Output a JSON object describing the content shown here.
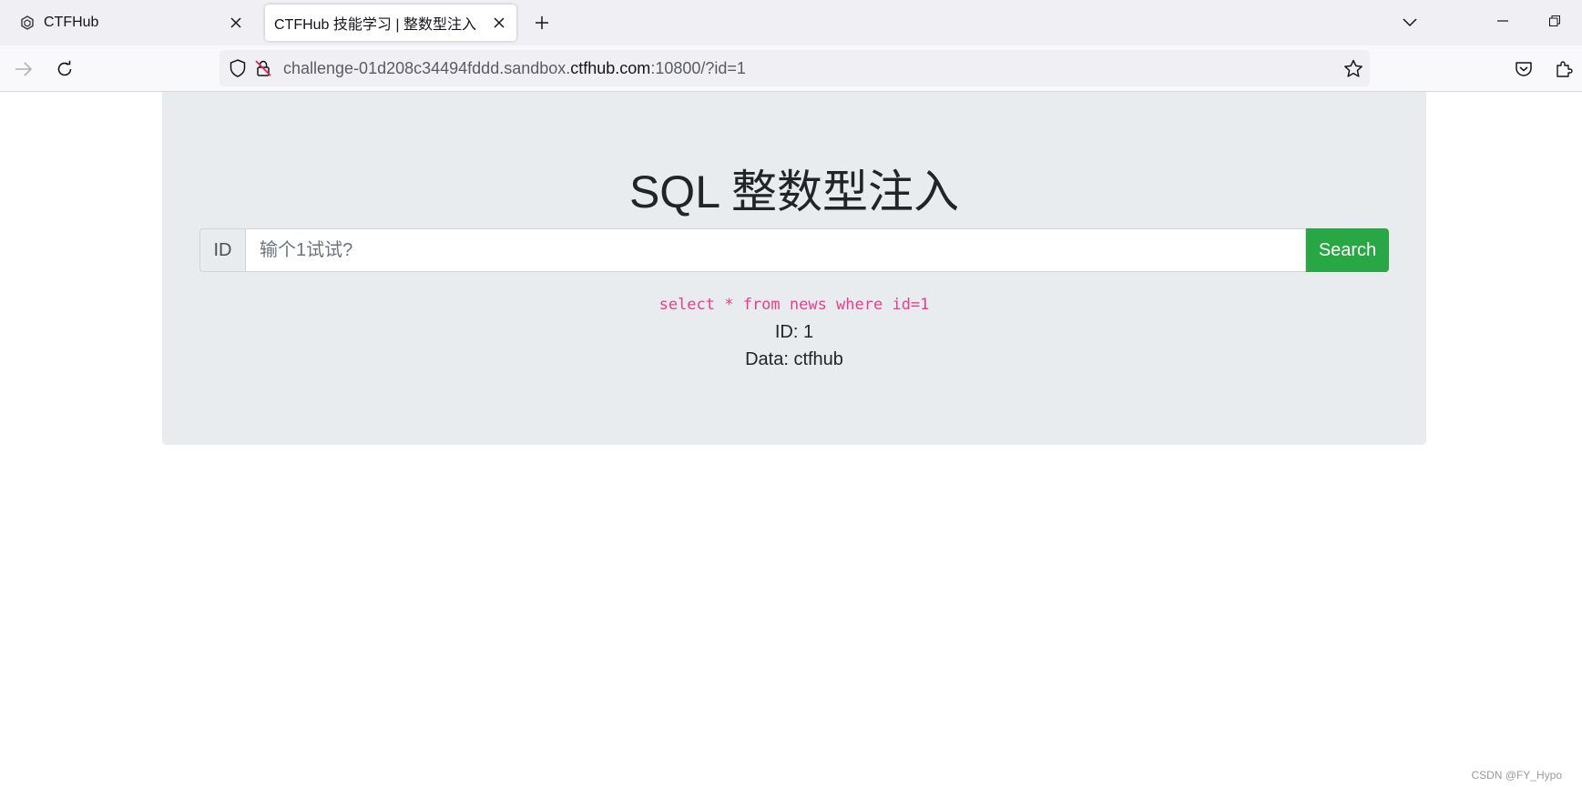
{
  "browser": {
    "tabs": [
      {
        "title": "CTFHub",
        "active": false
      },
      {
        "title": "CTFHub 技能学习 | 整数型注入",
        "active": true
      }
    ],
    "url": {
      "prefix": "challenge-01d208c34494fddd.sandbox.",
      "host": "ctfhub.com",
      "suffix": ":10800/?id=1"
    },
    "icons": {
      "tab_favicon": "ctfhub-favicon-icon",
      "tab_close": "close-icon",
      "new_tab": "plus-icon",
      "tab_list": "chevron-down-icon",
      "minimize": "minimize-icon",
      "restore": "restore-icon",
      "forward": "arrow-right-icon",
      "reload": "reload-icon",
      "tracking_protection": "shield-icon",
      "insecure": "insecure-lock-icon",
      "bookmark": "star-icon",
      "pocket": "pocket-icon",
      "extensions": "puzzle-icon"
    }
  },
  "page": {
    "title": "SQL 整数型注入",
    "input_prefix": "ID",
    "input_placeholder": "输个1试试?",
    "input_value": "",
    "search_label": "Search",
    "query": "select * from news where id=1",
    "result_id": "ID: 1",
    "result_data": "Data: ctfhub"
  },
  "watermark": "CSDN @FY_Hypo",
  "colors": {
    "jumbotron_bg": "#e9ecef",
    "search_button": "#28a745",
    "code": "#e83e8c"
  }
}
